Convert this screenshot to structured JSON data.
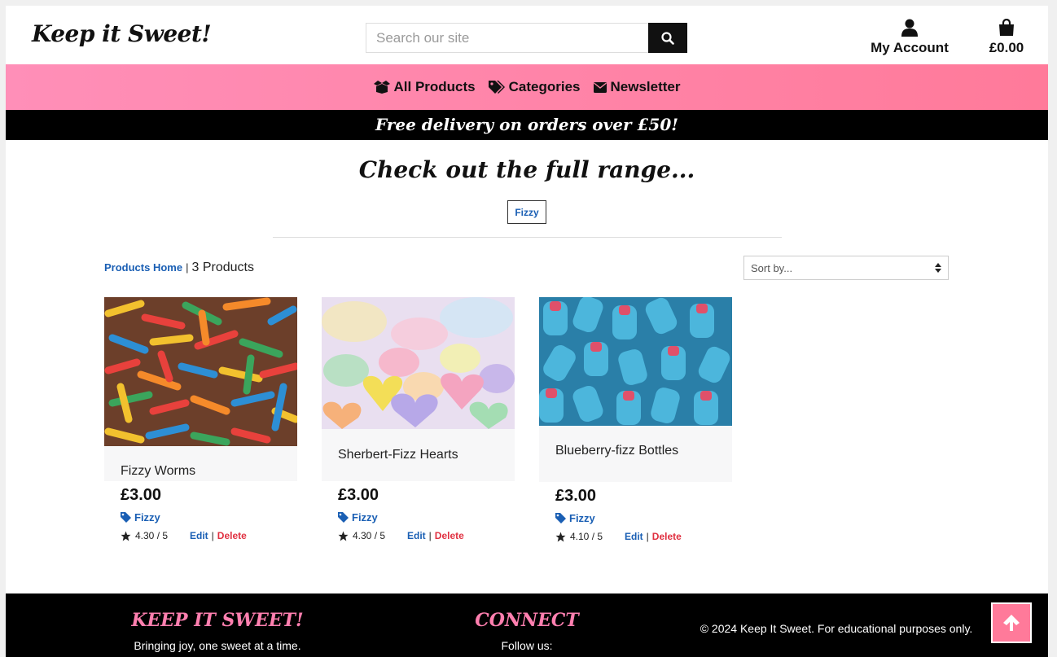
{
  "header": {
    "logo": "Keep it Sweet!",
    "search_placeholder": "Search our site",
    "account_label": "My Account",
    "bag_total": "£0.00"
  },
  "nav": {
    "items": [
      {
        "label": "All Products",
        "icon": "box-open-icon"
      },
      {
        "label": "Categories",
        "icon": "tags-icon"
      },
      {
        "label": "Newsletter",
        "icon": "envelope-icon"
      }
    ]
  },
  "banner": "Free delivery on orders over £50!",
  "main": {
    "title": "Check out the full range...",
    "category_filter": "Fizzy",
    "breadcrumb_link": "Products Home",
    "breadcrumb_sep": "|",
    "product_count": "3 Products",
    "sort_placeholder": "Sort by..."
  },
  "products": [
    {
      "name": "Fizzy Worms",
      "price": "£3.00",
      "category": "Fizzy",
      "rating": "4.30 / 5",
      "edit": "Edit",
      "delete": "Delete"
    },
    {
      "name": "Sherbert-Fizz Hearts",
      "price": "£3.00",
      "category": "Fizzy",
      "rating": "4.30 / 5",
      "edit": "Edit",
      "delete": "Delete"
    },
    {
      "name": "Blueberry-fizz Bottles",
      "price": "£3.00",
      "category": "Fizzy",
      "rating": "4.10 / 5",
      "edit": "Edit",
      "delete": "Delete"
    }
  ],
  "footer": {
    "brand": "KEEP IT SWEET!",
    "tagline": "Bringing joy, one sweet at a time.",
    "connect_title": "CONNECT",
    "follow": "Follow us:",
    "copyright": "© 2024 Keep It Sweet. For educational purposes only."
  },
  "colors": {
    "nav_gradient_start": "#ff8fb8",
    "nav_gradient_end": "#ff7a9a",
    "link_blue": "#1a5fb4",
    "delete_red": "#e03040",
    "footer_pink": "#ff7faf"
  }
}
